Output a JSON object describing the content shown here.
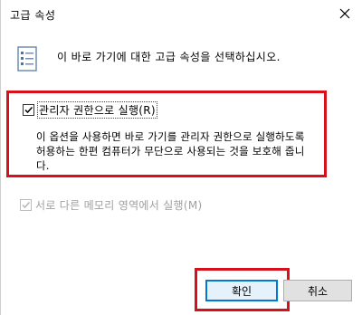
{
  "window": {
    "title": "고급 속성",
    "close_symbol": "✕"
  },
  "header": {
    "icon": "properties-list-icon",
    "text": "이 바로 가기에 대한 고급 속성을 선택하십시오."
  },
  "options": {
    "run_as_admin": {
      "label": "관리자 권한으로 실행(R)",
      "checked": true,
      "description_lines": [
        "이 옵션을 사용하면 바로 가기를 관리자 권한으로 실행하도록",
        "허용하는 한편 컴퓨터가 무단으로 사용되는 것을 보호해 줍니",
        "다."
      ]
    },
    "separate_memory": {
      "label": "서로 다른 메모리 영역에서 실행(M)",
      "checked": true,
      "enabled": false
    }
  },
  "buttons": {
    "ok_label": "확인",
    "cancel_label": "취소"
  },
  "colors": {
    "highlight_red": "#d6111b",
    "focus_blue": "#0078d7"
  }
}
